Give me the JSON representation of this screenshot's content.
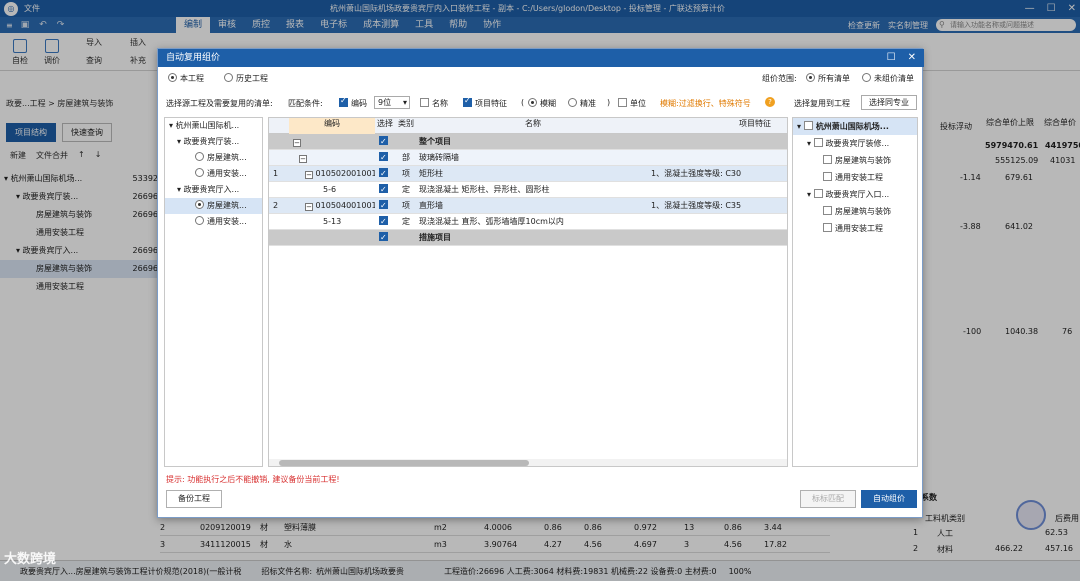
{
  "titlebar": {
    "file_menu": "文件",
    "title": "杭州萧山国际机场政要贵宾厅内入口装修工程 - 副本 - C:/Users/glodon/Desktop - 投标管理 - 广联达预算计价",
    "check_update": "检查更新",
    "real_name": "实名制管理",
    "search_placeholder": "请输入功能名称或问题描述"
  },
  "menu_tabs": [
    "编制",
    "审核",
    "质控",
    "报表",
    "电子标",
    "成本测算",
    "工具",
    "帮助",
    "协作"
  ],
  "ribbon": {
    "buttons": [
      "自检",
      "调价",
      "导入",
      "查询",
      "插入",
      "补充"
    ]
  },
  "left_panel": {
    "breadcrumb": "政要...工程 > 房屋建筑与装饰",
    "btn_structure": "项目结构",
    "btn_quick": "快速查询",
    "tool_new": "新建",
    "tool_merge": "文件合并",
    "tree": [
      {
        "label": "杭州萧山国际机场...",
        "num": "53392"
      },
      {
        "label": "政要贵宾厅装...",
        "num": "26696"
      },
      {
        "label": "房屋建筑与装饰",
        "num": "26696"
      },
      {
        "label": "通用安装工程",
        "num": ""
      },
      {
        "label": "政要贵宾厅入...",
        "num": "26696"
      },
      {
        "label": "房屋建筑与装饰",
        "num": "26696"
      },
      {
        "label": "通用安装工程",
        "num": ""
      }
    ]
  },
  "background_right": {
    "col1": "投标浮动",
    "col2": "综合单价上限",
    "col3": "综合单价",
    "row_values": [
      "5979470.61",
      "4419750",
      "555125.09",
      "41031",
      "-1.14",
      "679.61",
      "-3.88",
      "641.02",
      "-100",
      "1040.38",
      "76"
    ]
  },
  "bottom_grid": {
    "rows": [
      [
        "2",
        "0209120019",
        "材",
        "塑料薄膜",
        "m2",
        "4.0006",
        "0.86",
        "0.86",
        "0.972",
        "13",
        "0.86",
        "3.44"
      ],
      [
        "3",
        "3411120015",
        "材",
        "水",
        "m3",
        "3.90764",
        "4.27",
        "4.56",
        "4.697",
        "3",
        "4.56",
        "17.82"
      ]
    ]
  },
  "right_bottom": {
    "title": "系数",
    "col_type": "工料机类别",
    "col_fee": "后费用",
    "rows": [
      [
        "1",
        "人工",
        "62.53"
      ],
      [
        "2",
        "材料",
        "466.22",
        "457.16"
      ]
    ]
  },
  "status_bar": {
    "left": "政要贵宾厅入...房屋建筑与装饰工程计价规范(2018)(一般计税",
    "file": "招标文件名称:",
    "file_name": "杭州萧山国际机场政要贵",
    "totals": "工程造价:26696  人工费:3064  材料费:19831  机械费:22  设备费:0  主材费:0",
    "zoom": "100%"
  },
  "watermark": "大数跨境",
  "dialog": {
    "title": "自动复用组价",
    "radio_this": "本工程",
    "radio_history": "历史工程",
    "scope_label": "组价范围:",
    "scope_all": "所有清单",
    "scope_none": "未组价清单",
    "select_label": "选择源工程及需要复用的清单:",
    "match_label": "匹配条件:",
    "code_label": "编码",
    "code_digits": "9位",
    "name_label": "名称",
    "feature_label": "项目特征",
    "fuzzy_label": "模糊",
    "exact_label": "精准",
    "unit_label": "单位",
    "hint": "模糊:过滤换行、特殊符号",
    "target_label": "选择复用到工程",
    "same_major": "选择同专业",
    "source_tree": [
      {
        "label": "杭州萧山国际机...",
        "type": "root"
      },
      {
        "label": "政要贵宾厅装...",
        "type": "node"
      },
      {
        "label": "房屋建筑...",
        "type": "leaf"
      },
      {
        "label": "通用安装...",
        "type": "leaf"
      },
      {
        "label": "政要贵宾厅入...",
        "type": "node"
      },
      {
        "label": "房屋建筑...",
        "type": "leaf-sel"
      },
      {
        "label": "通用安装...",
        "type": "leaf"
      }
    ],
    "grid": {
      "headers": [
        "编码",
        "选择",
        "类别",
        "名称",
        "项目特征"
      ],
      "rows": [
        {
          "idx": "",
          "code": "",
          "type": "",
          "name": "整个项目",
          "feature": "",
          "style": "gray",
          "bold": true
        },
        {
          "idx": "",
          "code": "",
          "type": "部",
          "name": "玻璃砖隔墙",
          "feature": "",
          "style": "lblue"
        },
        {
          "idx": "1",
          "code": "010502001001",
          "type": "项",
          "name": "矩形柱",
          "feature": "1、混凝土强度等级: C30",
          "style": "blue"
        },
        {
          "idx": "",
          "code": "5-6",
          "type": "定",
          "name": "现浇混凝土 矩形柱、异形柱、圆形柱",
          "feature": "",
          "style": ""
        },
        {
          "idx": "2",
          "code": "010504001001",
          "type": "项",
          "name": "直形墙",
          "feature": "1、混凝土强度等级: C35",
          "style": "blue"
        },
        {
          "idx": "",
          "code": "5-13",
          "type": "定",
          "name": "现浇混凝土 直形、弧形墙墙厚10cm以内",
          "feature": "",
          "style": ""
        },
        {
          "idx": "",
          "code": "",
          "type": "",
          "name": "措施项目",
          "feature": "",
          "style": "gray",
          "bold": true
        }
      ]
    },
    "target_tree": [
      {
        "label": "杭州萧山国际机场...",
        "type": "head"
      },
      {
        "label": "政要贵宾厅装修...",
        "type": "node"
      },
      {
        "label": "房屋建筑与装饰",
        "type": "leaf"
      },
      {
        "label": "通用安装工程",
        "type": "leaf"
      },
      {
        "label": "政要贵宾厅入口...",
        "type": "node"
      },
      {
        "label": "房屋建筑与装饰",
        "type": "leaf"
      },
      {
        "label": "通用安装工程",
        "type": "leaf"
      }
    ],
    "tip": "提示: 功能执行之后不能撤销, 建议备份当前工程!",
    "backup_btn": "备份工程",
    "match_btn": "标标匹配",
    "auto_btn": "自动组价"
  }
}
